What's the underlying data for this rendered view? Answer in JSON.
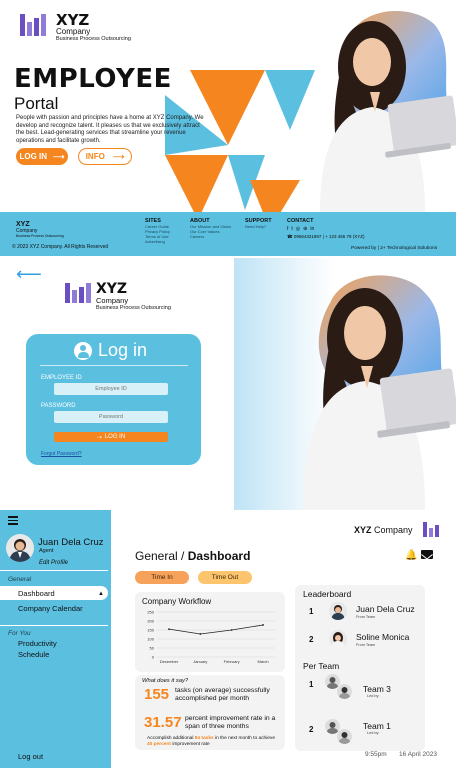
{
  "brand": {
    "name": "XYZ",
    "company": "Company",
    "tagline": "Business Process Outsourcing"
  },
  "landing": {
    "title": "EMPLOYEE",
    "subtitle": "Portal",
    "body": "People with passion and principles have a home at XYZ Company. We develop and recognize talent. It pleases us that we exclusively attract the best. Lead-generating services that streamline your revenue operations and facilitate growth.",
    "login_label": "LOG IN",
    "info_label": "INFO",
    "footer": {
      "brand": "XYZ",
      "company": "Company",
      "tagline": "Business Process Outsourcing",
      "copyright": "© 2023 XYZ Company. All Rights Reserved",
      "sites_title": "SITES",
      "sites_items": [
        "Career Guide",
        "Privacy Policy",
        "Terms of Use",
        "Advertising"
      ],
      "about_title": "ABOUT",
      "about_items": [
        "Our Mission and Vision",
        "Our Core Values",
        "Careers"
      ],
      "support_title": "SUPPORT",
      "support_items": [
        "Need Help?"
      ],
      "contact_title": "CONTACT",
      "phones": "09564321897 | + 123 456 78 (XYZ)",
      "powered": "Powered by | 2+ Technological Solutions"
    }
  },
  "login": {
    "brand": "XYZ",
    "company": "Company",
    "tagline": "Business Process Outsourcing",
    "title": "Log in",
    "employee_id_label": "EMPLOYEE ID",
    "employee_id_placeholder": "Employee ID",
    "password_label": "PASSWORD",
    "password_placeholder": "Password",
    "submit_label": "LOG IN",
    "forgot_label": "Forgot Password?"
  },
  "dashboard": {
    "user": {
      "name": "Juan Dela Cruz",
      "role": "Agent",
      "edit_label": "Edit Profile"
    },
    "nav": {
      "general_label": "General",
      "general_items": [
        "Dashboard",
        "Company Calendar"
      ],
      "foryou_label": "For You",
      "foryou_items": [
        "Productivity",
        "Schedule"
      ],
      "logout_label": "Log out"
    },
    "header": {
      "brand": "XYZ",
      "company": "Company"
    },
    "breadcrumb": {
      "section": "General",
      "separator": "/",
      "page": "Dashboard"
    },
    "time_in_label": "Time In",
    "time_out_label": "Time Out",
    "workflow": {
      "title": "Company Workflow"
    },
    "insight": {
      "title": "What does it say?",
      "stat1_value": "155",
      "stat1_text": "tasks (on average) successfully accomplished per month",
      "stat2_value": "31.57",
      "stat2_text": "percent improvement rate in a span of three months",
      "foot_a": "Accomplish additional ",
      "foot_b": "84 tasks",
      "foot_c": " in the next month to achieve ",
      "foot_d": "40 percent",
      "foot_e": " improvement rate"
    },
    "leaderboard": {
      "title": "Leaderboard",
      "entries": [
        {
          "rank": "1",
          "name": "Juan Dela Cruz",
          "sub": "From Team"
        },
        {
          "rank": "2",
          "name": "Soline Monica",
          "sub": "From Team"
        }
      ],
      "team_title": "Per Team",
      "teams": [
        {
          "rank": "1",
          "name": "Team 3",
          "sub": "Led by:"
        },
        {
          "rank": "2",
          "name": "Team 1",
          "sub": "Led by:"
        }
      ]
    },
    "time": "9:55pm",
    "date": "16 April 2023"
  },
  "chart_data": {
    "type": "line",
    "title": "Company Workflow",
    "categories": [
      "December",
      "January",
      "February",
      "March"
    ],
    "values": [
      155,
      128,
      150,
      178
    ],
    "ylim": [
      0,
      250
    ],
    "yticks": [
      0,
      50,
      100,
      150,
      200,
      250
    ],
    "grid": true
  },
  "colors": {
    "accent_orange": "#f5861f",
    "accent_blue": "#5bbfe0",
    "brand_purple": "#6b4fc2"
  }
}
